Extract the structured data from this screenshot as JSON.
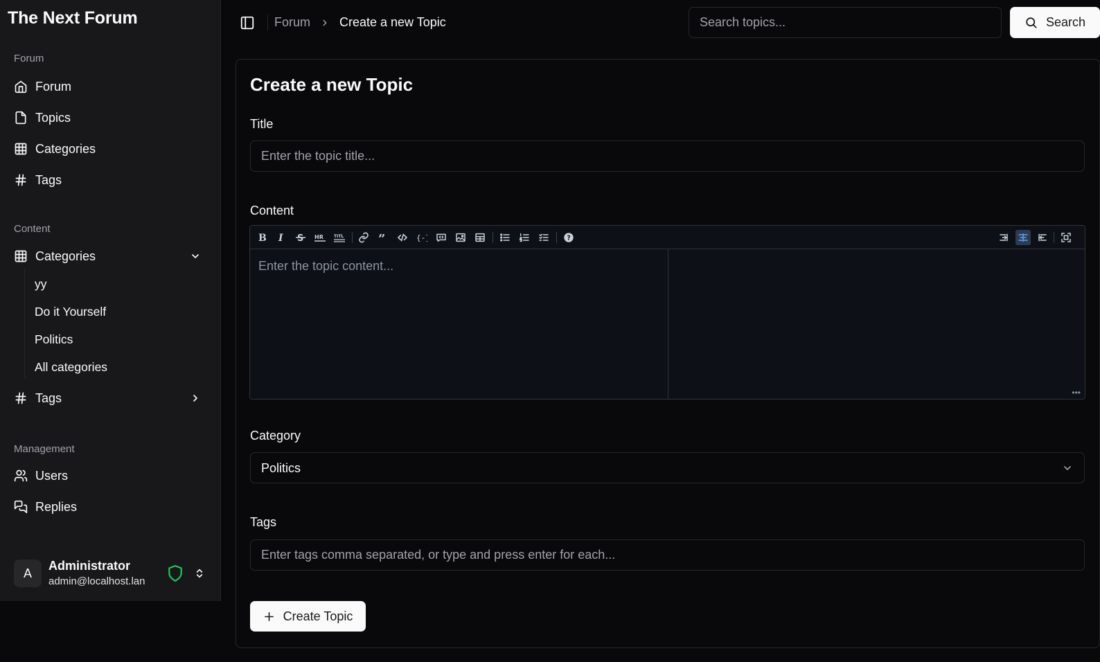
{
  "app": {
    "title": "The Next Forum"
  },
  "sidebar": {
    "groups": [
      {
        "label": "Forum",
        "items": [
          {
            "label": "Forum",
            "icon": "home-icon"
          },
          {
            "label": "Topics",
            "icon": "file-icon"
          },
          {
            "label": "Categories",
            "icon": "grid-icon"
          },
          {
            "label": "Tags",
            "icon": "hash-icon"
          }
        ]
      },
      {
        "label": "Content",
        "items": [
          {
            "label": "Categories",
            "icon": "grid-icon",
            "expanded": true,
            "children": [
              "yy",
              "Do it Yourself",
              "Politics",
              "All categories"
            ]
          },
          {
            "label": "Tags",
            "icon": "hash-icon",
            "expanded": false
          }
        ]
      },
      {
        "label": "Management",
        "items": [
          {
            "label": "Users",
            "icon": "users-icon"
          },
          {
            "label": "Replies",
            "icon": "messages-icon"
          }
        ]
      }
    ],
    "user": {
      "initial": "A",
      "name": "Administrator",
      "email": "admin@localhost.lan",
      "badge_color": "#22c55e"
    }
  },
  "header": {
    "breadcrumb": [
      "Forum",
      "Create a new Topic"
    ],
    "search": {
      "placeholder": "Search topics...",
      "button_label": "Search"
    }
  },
  "form": {
    "heading": "Create a new Topic",
    "title": {
      "label": "Title",
      "placeholder": "Enter the topic title...",
      "value": ""
    },
    "content": {
      "label": "Content",
      "placeholder": "Enter the topic content...",
      "toolbar_left": [
        "bold-icon",
        "italic-icon",
        "strikethrough-icon",
        "hr-icon",
        "title-icon",
        "link-icon",
        "quote-icon",
        "code-icon",
        "code-block-icon",
        "comment-icon",
        "image-icon",
        "table-icon",
        "unordered-list-icon",
        "ordered-list-icon",
        "checked-list-icon",
        "help-icon"
      ],
      "toolbar_right": [
        "edit-mode-icon",
        "live-mode-icon",
        "preview-mode-icon",
        "fullscreen-icon"
      ],
      "active_mode": "live-mode-icon"
    },
    "category": {
      "label": "Category",
      "selected": "Politics"
    },
    "tags": {
      "label": "Tags",
      "placeholder": "Enter tags comma separated, or type and press enter for each..."
    },
    "submit_label": "Create Topic"
  }
}
